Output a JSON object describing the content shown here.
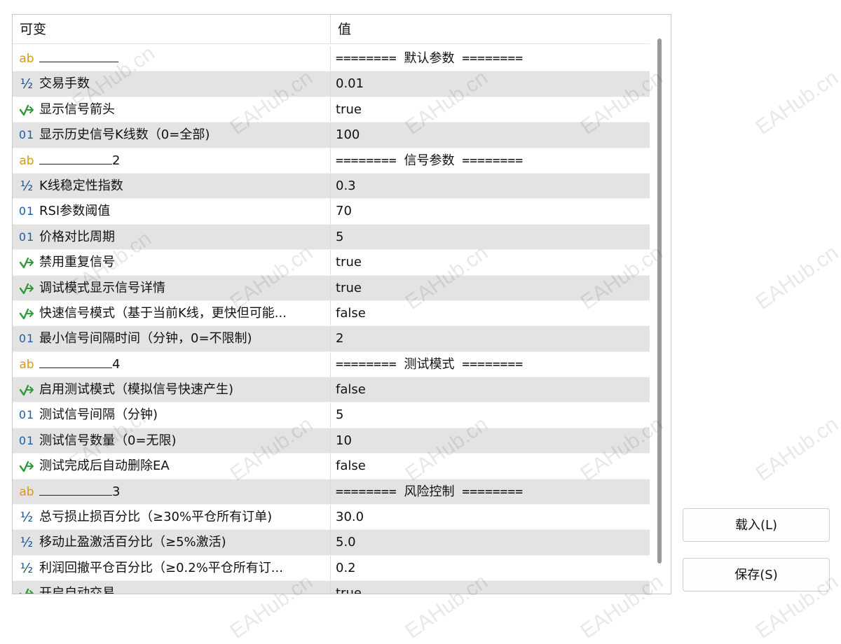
{
  "header": {
    "col_variable": "可变",
    "col_value": "值"
  },
  "rows": [
    {
      "icon": "ab",
      "name": "",
      "suffix": "",
      "value": "======== 默认参数 ========",
      "section": true
    },
    {
      "icon": "half",
      "name": "交易手数",
      "value": "0.01"
    },
    {
      "icon": "bool",
      "name": "显示信号箭头",
      "value": "true"
    },
    {
      "icon": "int",
      "name": "显示历史信号K线数（0=全部)",
      "value": "100"
    },
    {
      "icon": "ab",
      "name": "",
      "suffix": "2",
      "value": "======== 信号参数 ========",
      "section": true
    },
    {
      "icon": "half",
      "name": "K线稳定性指数",
      "value": "0.3"
    },
    {
      "icon": "int",
      "name": "RSI参数阈值",
      "value": "70"
    },
    {
      "icon": "int",
      "name": "价格对比周期",
      "value": "5"
    },
    {
      "icon": "bool",
      "name": "禁用重复信号",
      "value": "true"
    },
    {
      "icon": "bool",
      "name": "调试模式显示信号详情",
      "value": "true"
    },
    {
      "icon": "bool",
      "name": "快速信号模式（基于当前K线，更快但可能...",
      "value": "false"
    },
    {
      "icon": "int",
      "name": "最小信号间隔时间（分钟，0=不限制)",
      "value": "2"
    },
    {
      "icon": "ab",
      "name": "",
      "suffix": "4",
      "value": "======== 测试模式 ========",
      "section": true
    },
    {
      "icon": "bool",
      "name": "启用测试模式（模拟信号快速产生)",
      "value": "false"
    },
    {
      "icon": "int",
      "name": "测试信号间隔（分钟)",
      "value": "5"
    },
    {
      "icon": "int",
      "name": "测试信号数量（0=无限)",
      "value": "10"
    },
    {
      "icon": "bool",
      "name": "测试完成后自动删除EA",
      "value": "false"
    },
    {
      "icon": "ab",
      "name": "",
      "suffix": "3",
      "value": "======== 风险控制 ========",
      "section": true
    },
    {
      "icon": "half",
      "name": "总亏损止损百分比（≥30%平仓所有订单)",
      "value": "30.0"
    },
    {
      "icon": "half",
      "name": "移动止盈激活百分比（≥5%激活)",
      "value": "5.0"
    },
    {
      "icon": "half",
      "name": "利润回撤平仓百分比（≥0.2%平仓所有订...",
      "value": "0.2"
    },
    {
      "icon": "bool",
      "name": "开启自动交易",
      "value": "true"
    }
  ],
  "buttons": {
    "load": "载入(L)",
    "save": "保存(S)"
  },
  "watermark": "EAHub.cn",
  "icons": {
    "ab": "string-type-icon",
    "half": "double-type-icon",
    "int": "integer-type-icon",
    "bool": "bool-type-icon"
  },
  "colors": {
    "alt_row": "#e3e3e3",
    "string_icon": "#d79a17",
    "bool_icon": "#2e9b3a",
    "numeric_icon": "#1a4f8f"
  }
}
